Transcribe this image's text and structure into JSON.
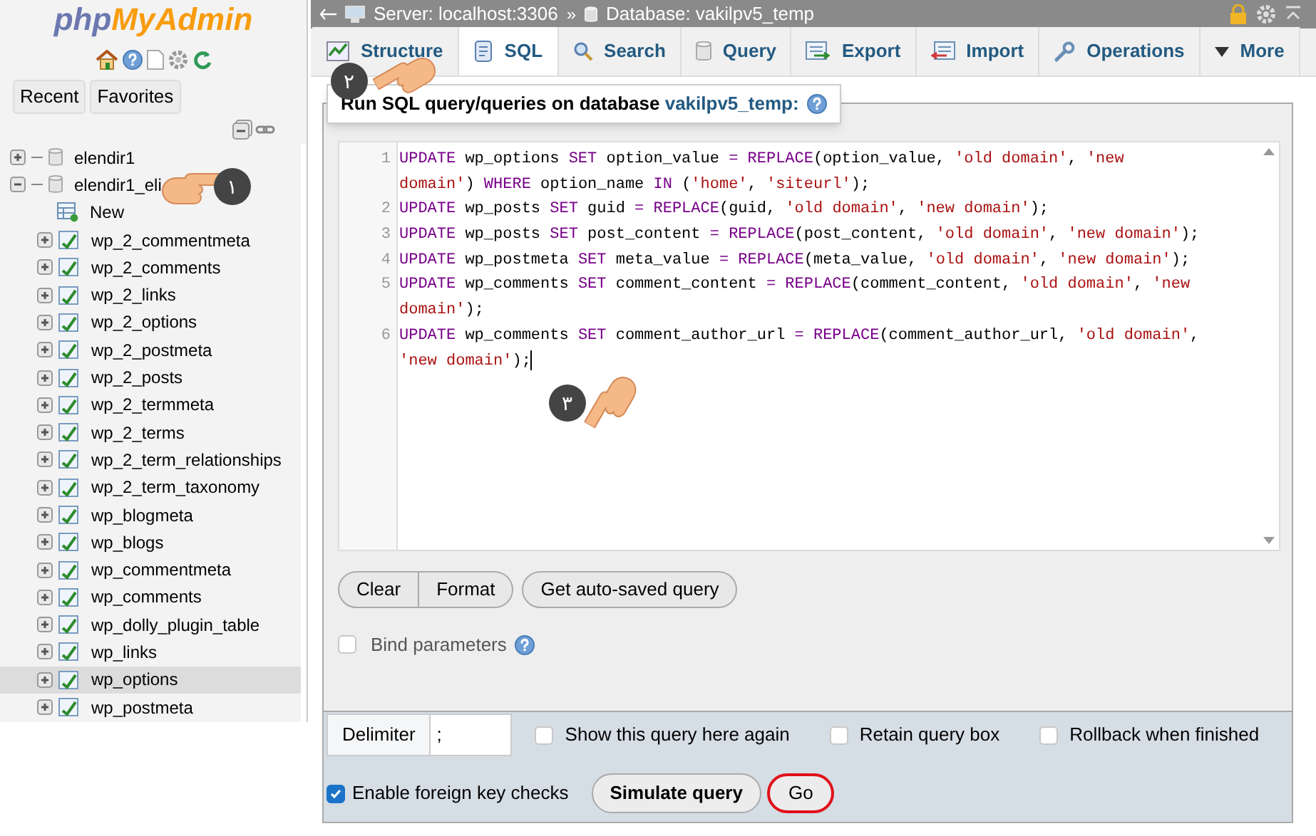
{
  "logo": {
    "part_1": "php",
    "part_2": "MyAdmin"
  },
  "nav_buttons": [
    "Recent",
    "Favorites"
  ],
  "tree": [
    {
      "label": "elendir1",
      "expanded": false
    },
    {
      "label": "elendir1_eli",
      "expanded": true,
      "children": [
        {
          "label": "New",
          "kind": "new",
          "selected": false
        },
        {
          "label": "wp_2_commentmeta",
          "kind": "table",
          "selected": false
        },
        {
          "label": "wp_2_comments",
          "kind": "table",
          "selected": false
        },
        {
          "label": "wp_2_links",
          "kind": "table",
          "selected": false
        },
        {
          "label": "wp_2_options",
          "kind": "table",
          "selected": false
        },
        {
          "label": "wp_2_postmeta",
          "kind": "table",
          "selected": false
        },
        {
          "label": "wp_2_posts",
          "kind": "table",
          "selected": false
        },
        {
          "label": "wp_2_termmeta",
          "kind": "table",
          "selected": false
        },
        {
          "label": "wp_2_terms",
          "kind": "table",
          "selected": false
        },
        {
          "label": "wp_2_term_relationships",
          "kind": "table",
          "selected": false
        },
        {
          "label": "wp_2_term_taxonomy",
          "kind": "table",
          "selected": false
        },
        {
          "label": "wp_blogmeta",
          "kind": "table",
          "selected": false
        },
        {
          "label": "wp_blogs",
          "kind": "table",
          "selected": false
        },
        {
          "label": "wp_commentmeta",
          "kind": "table",
          "selected": false
        },
        {
          "label": "wp_comments",
          "kind": "table",
          "selected": false
        },
        {
          "label": "wp_dolly_plugin_table",
          "kind": "table",
          "selected": false
        },
        {
          "label": "wp_links",
          "kind": "table",
          "selected": false
        },
        {
          "label": "wp_options",
          "kind": "table",
          "selected": true
        },
        {
          "label": "wp_postmeta",
          "kind": "table",
          "selected": false
        }
      ]
    }
  ],
  "breadcrumb": {
    "server": "Server: localhost:3306",
    "separator": "»",
    "database": "Database: vakilpv5_temp"
  },
  "tabs": [
    {
      "label": "Structure",
      "kind": "structure",
      "selected": false
    },
    {
      "label": "SQL",
      "kind": "sql",
      "selected": true
    },
    {
      "label": "Search",
      "kind": "search",
      "selected": false
    },
    {
      "label": "Query",
      "kind": "query",
      "selected": false
    },
    {
      "label": "Export",
      "kind": "export",
      "selected": false
    },
    {
      "label": "Import",
      "kind": "import",
      "selected": false
    },
    {
      "label": "Operations",
      "kind": "operations",
      "selected": false
    },
    {
      "label": "More",
      "kind": "more",
      "selected": false
    }
  ],
  "legend": {
    "text": "Run SQL query/queries on database",
    "database": "vakilpv5_temp:"
  },
  "editor": {
    "lines": [
      {
        "number": "1",
        "rows": [
          {
            "segments": [
              {
                "kind": "keyword",
                "text": "UPDATE"
              },
              {
                "kind": "plain",
                "text": " wp_options "
              },
              {
                "kind": "keyword",
                "text": "SET"
              },
              {
                "kind": "plain",
                "text": " option_value "
              },
              {
                "kind": "keyword",
                "text": "= "
              },
              {
                "kind": "keyword",
                "text": "REPLACE"
              },
              {
                "kind": "plain",
                "text": "(option_value, "
              },
              {
                "kind": "string",
                "text": "'old domain'"
              },
              {
                "kind": "plain",
                "text": ", "
              },
              {
                "kind": "string",
                "text": "'new"
              }
            ]
          },
          {
            "segments": [
              {
                "kind": "string",
                "text": "domain'"
              },
              {
                "kind": "plain",
                "text": ") "
              },
              {
                "kind": "keyword",
                "text": "WHERE"
              },
              {
                "kind": "plain",
                "text": " option_name "
              },
              {
                "kind": "keyword",
                "text": "IN"
              },
              {
                "kind": "plain",
                "text": " ("
              },
              {
                "kind": "string",
                "text": "'home'"
              },
              {
                "kind": "plain",
                "text": ", "
              },
              {
                "kind": "string",
                "text": "'siteurl'"
              },
              {
                "kind": "plain",
                "text": ");"
              }
            ]
          }
        ]
      },
      {
        "number": "2",
        "rows": [
          {
            "segments": [
              {
                "kind": "keyword",
                "text": "UPDATE"
              },
              {
                "kind": "plain",
                "text": " wp_posts "
              },
              {
                "kind": "keyword",
                "text": "SET"
              },
              {
                "kind": "plain",
                "text": " guid "
              },
              {
                "kind": "keyword",
                "text": "= "
              },
              {
                "kind": "keyword",
                "text": "REPLACE"
              },
              {
                "kind": "plain",
                "text": "(guid, "
              },
              {
                "kind": "string",
                "text": "'old domain'"
              },
              {
                "kind": "plain",
                "text": ", "
              },
              {
                "kind": "string",
                "text": "'new domain'"
              },
              {
                "kind": "plain",
                "text": ");"
              }
            ]
          }
        ]
      },
      {
        "number": "3",
        "rows": [
          {
            "segments": [
              {
                "kind": "keyword",
                "text": "UPDATE"
              },
              {
                "kind": "plain",
                "text": " wp_posts "
              },
              {
                "kind": "keyword",
                "text": "SET"
              },
              {
                "kind": "plain",
                "text": " post_content "
              },
              {
                "kind": "keyword",
                "text": "= "
              },
              {
                "kind": "keyword",
                "text": "REPLACE"
              },
              {
                "kind": "plain",
                "text": "(post_content, "
              },
              {
                "kind": "string",
                "text": "'old domain'"
              },
              {
                "kind": "plain",
                "text": ", "
              },
              {
                "kind": "string",
                "text": "'new domain'"
              },
              {
                "kind": "plain",
                "text": ");"
              }
            ]
          }
        ]
      },
      {
        "number": "4",
        "rows": [
          {
            "segments": [
              {
                "kind": "keyword",
                "text": "UPDATE"
              },
              {
                "kind": "plain",
                "text": " wp_postmeta "
              },
              {
                "kind": "keyword",
                "text": "SET"
              },
              {
                "kind": "plain",
                "text": " meta_value "
              },
              {
                "kind": "keyword",
                "text": "= "
              },
              {
                "kind": "keyword",
                "text": "REPLACE"
              },
              {
                "kind": "plain",
                "text": "(meta_value, "
              },
              {
                "kind": "string",
                "text": "'old domain'"
              },
              {
                "kind": "plain",
                "text": ", "
              },
              {
                "kind": "string",
                "text": "'new domain'"
              },
              {
                "kind": "plain",
                "text": ");"
              }
            ]
          }
        ]
      },
      {
        "number": "5",
        "rows": [
          {
            "segments": [
              {
                "kind": "keyword",
                "text": "UPDATE"
              },
              {
                "kind": "plain",
                "text": " wp_comments "
              },
              {
                "kind": "keyword",
                "text": "SET"
              },
              {
                "kind": "plain",
                "text": " comment_content "
              },
              {
                "kind": "keyword",
                "text": "= "
              },
              {
                "kind": "keyword",
                "text": "REPLACE"
              },
              {
                "kind": "plain",
                "text": "(comment_content, "
              },
              {
                "kind": "string",
                "text": "'old domain'"
              },
              {
                "kind": "plain",
                "text": ", "
              },
              {
                "kind": "string",
                "text": "'new"
              }
            ]
          },
          {
            "segments": [
              {
                "kind": "string",
                "text": "domain'"
              },
              {
                "kind": "plain",
                "text": ");"
              }
            ]
          }
        ]
      },
      {
        "number": "6",
        "rows": [
          {
            "segments": [
              {
                "kind": "keyword",
                "text": "UPDATE"
              },
              {
                "kind": "plain",
                "text": " wp_comments "
              },
              {
                "kind": "keyword",
                "text": "SET"
              },
              {
                "kind": "plain",
                "text": " comment_author_url "
              },
              {
                "kind": "keyword",
                "text": "= "
              },
              {
                "kind": "keyword",
                "text": "REPLACE"
              },
              {
                "kind": "plain",
                "text": "(comment_author_url, "
              },
              {
                "kind": "string",
                "text": "'old domain'"
              },
              {
                "kind": "plain",
                "text": ","
              }
            ]
          },
          {
            "segments": [
              {
                "kind": "string",
                "text": "'new domain'"
              },
              {
                "kind": "plain",
                "text": ");"
              }
            ]
          }
        ]
      }
    ]
  },
  "editor_buttons": [
    "Clear",
    "Format"
  ],
  "autosave_button": "Get auto-saved query",
  "bind_parameters": {
    "label": "Bind parameters",
    "checked": false
  },
  "delimiter": {
    "label": "Delimiter",
    "value": ";"
  },
  "options": [
    {
      "label": "Show this query here again",
      "checked": false
    },
    {
      "label": "Retain query box",
      "checked": false
    },
    {
      "label": "Rollback when finished",
      "checked": false
    }
  ],
  "foreign_keys": {
    "label": "Enable foreign key checks",
    "checked": true
  },
  "simulate_button": "Simulate query",
  "go_button": "Go",
  "callouts": [
    "۱",
    "۲",
    "۳"
  ]
}
